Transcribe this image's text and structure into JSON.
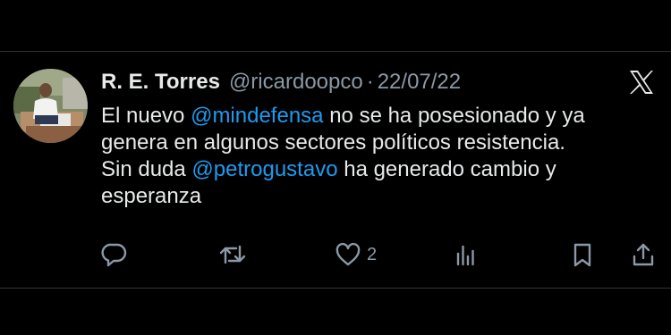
{
  "tweet": {
    "display_name": "R. E.  Torres",
    "handle": "@ricardoopco",
    "separator": "·",
    "date": "22/07/22",
    "text": {
      "line1": {
        "pre": "El nuevo ",
        "mention": "@mindefensa",
        "post": " no se ha posesionado y ya"
      },
      "line2": "genera en algunos sectores políticos resistencia.",
      "line3": {
        "pre": "Sin duda ",
        "mention": "@petrogustavo",
        "post": " ha generado cambio y"
      },
      "line4": "esperanza"
    },
    "actions": {
      "reply_icon": "reply-icon",
      "repost_icon": "repost-icon",
      "like_icon": "heart-icon",
      "like_count": "2",
      "views_icon": "views-chart-icon",
      "bookmark_icon": "bookmark-icon",
      "share_icon": "share-icon"
    }
  },
  "colors": {
    "background": "#000000",
    "text": "#e7e9ea",
    "muted": "#8b98a5",
    "link": "#1d9bf0",
    "divider": "#2f3336"
  },
  "brand": {
    "logo": "x-logo-icon"
  }
}
